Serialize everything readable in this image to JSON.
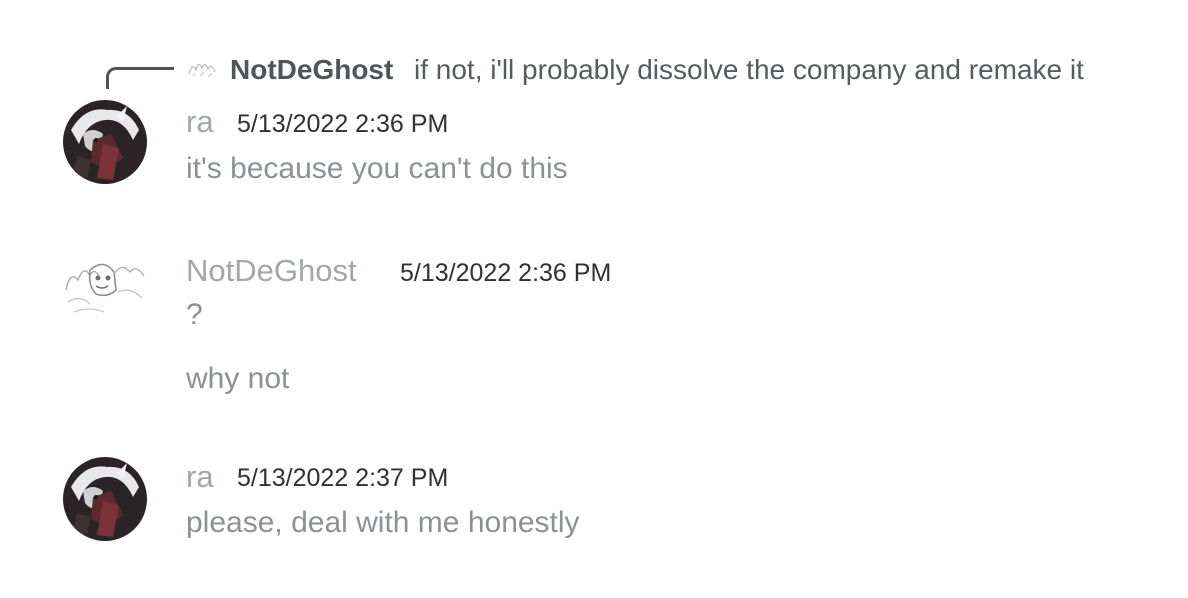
{
  "reply": {
    "author": "NotDeGhost",
    "text": "if not, i'll probably dissolve the company and remake it"
  },
  "messages": [
    {
      "author": "ra",
      "timestamp": "5/13/2022 2:36 PM",
      "lines": [
        "it's because you can't do this"
      ]
    },
    {
      "author": "NotDeGhost",
      "timestamp": "5/13/2022 2:36 PM",
      "lines": [
        "?",
        "why not"
      ]
    },
    {
      "author": "ra",
      "timestamp": "5/13/2022 2:37 PM",
      "lines": [
        "please, deal with me honestly"
      ]
    }
  ],
  "colors": {
    "author": "#a3a6aa",
    "timestamp": "#2f3136",
    "message": "#8d9095",
    "reply_author": "#515459",
    "spine": "#4f5358"
  }
}
